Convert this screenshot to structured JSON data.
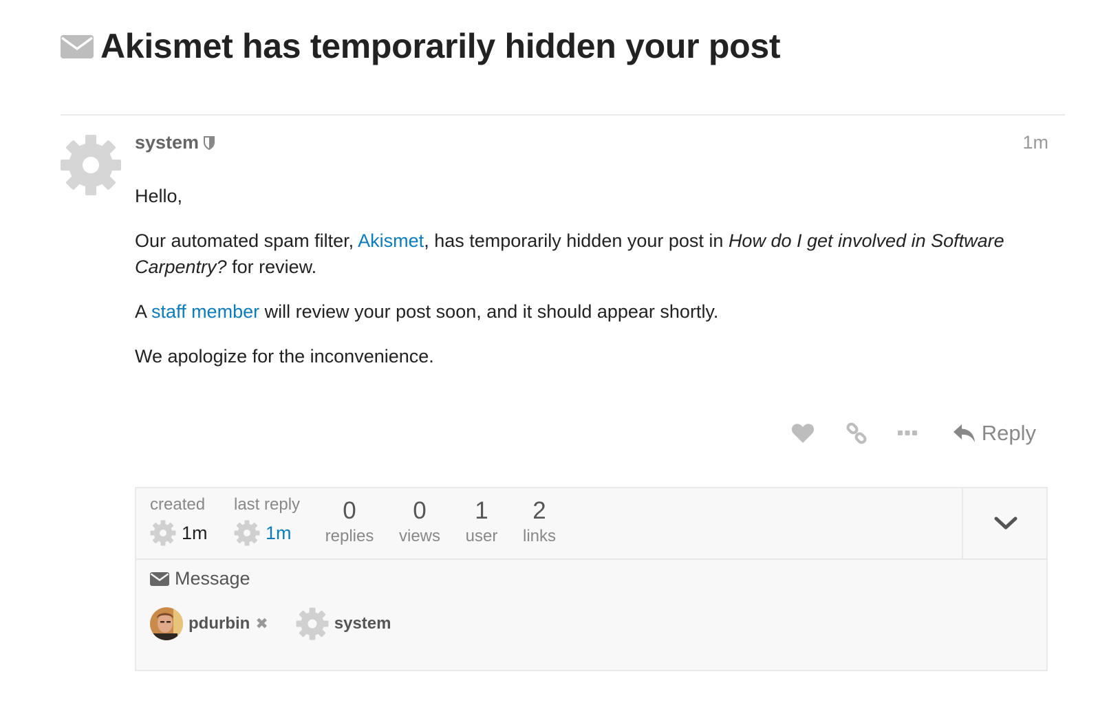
{
  "topic": {
    "title": "Akismet has temporarily hidden your post",
    "icon": "envelope-icon"
  },
  "post": {
    "username": "system",
    "badge_icon": "shield-icon",
    "age": "1m",
    "greeting": "Hello,",
    "para1_prefix": "Our automated spam filter, ",
    "para1_link": "Akismet",
    "para1_mid": ", has temporarily hidden your post in ",
    "para1_topic": "How do I get involved in Software Carpentry?",
    "para1_suffix": " for review.",
    "para2_prefix": "A ",
    "para2_link": "staff member",
    "para2_suffix": " will review your post soon, and it should appear shortly.",
    "para3": "We apologize for the inconvenience.",
    "reply_label": "Reply"
  },
  "topic_map": {
    "created_label": "created",
    "created_value": "1m",
    "last_reply_label": "last reply",
    "last_reply_value": "1m",
    "replies_count": "0",
    "replies_label": "replies",
    "views_count": "0",
    "views_label": "views",
    "users_count": "1",
    "users_label": "user",
    "links_count": "2",
    "links_label": "links",
    "message_label": "Message",
    "participants": [
      {
        "name": "pdurbin",
        "removable": true
      },
      {
        "name": "system",
        "removable": false
      }
    ],
    "remove_glyph": "✖"
  },
  "colors": {
    "link": "#0a7bbd",
    "icon_gray": "#bbbbbb",
    "text": "#222222"
  }
}
